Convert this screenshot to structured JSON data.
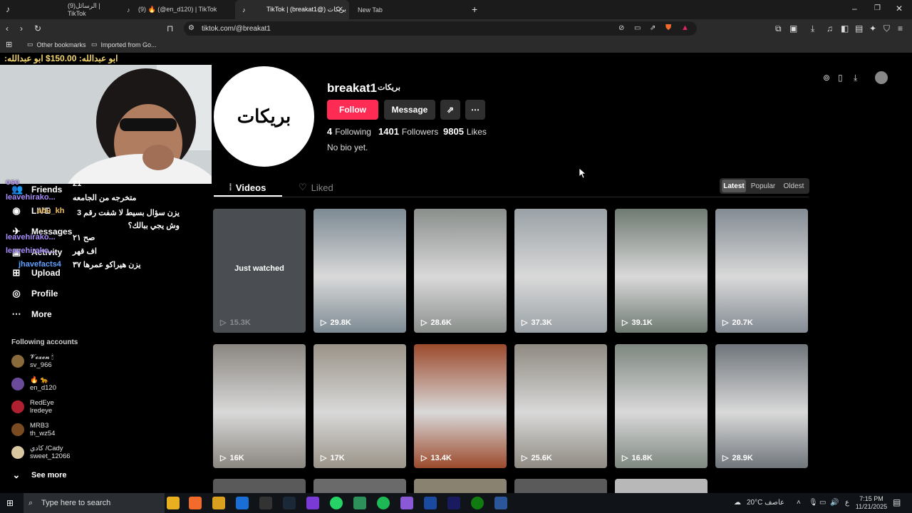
{
  "browser": {
    "tabs": [
      {
        "label": "(9)الرسائل | TikTok",
        "active": false
      },
      {
        "label": "(9) 🔥 (@en_d120) | TikTok",
        "active": false
      },
      {
        "label": "TikTok | (breakat1@) بريكات",
        "active": true
      },
      {
        "label": "New Tab",
        "active": false
      }
    ],
    "url": "tiktok.com/@breakat1",
    "bookmarks": [
      "Other bookmarks",
      "Imported from Go..."
    ]
  },
  "stream_overlay": {
    "top_text": "ابو عبدالله: 150.00$ ابو عبدالله:",
    "chat": [
      {
        "name": "leavehirako...",
        "msg": "متخرجه من الجامعه"
      },
      {
        "name": "abu_kh",
        "msg": "يزن سؤال بسيط لا شفت رقم 3 وش يجي ببالك؟"
      },
      {
        "name": "leavehirako...",
        "msg": "صح ٢١"
      },
      {
        "name": "leavehirako...",
        "msg": "اف قهر"
      },
      {
        "name": "jhavefacts4",
        "msg": "يزن هيراكو عمرها ٣٧"
      }
    ],
    "partial_num": "21"
  },
  "sidebar": {
    "items": [
      {
        "label": "Friends",
        "icon": "friends-icon"
      },
      {
        "label": "LIVE",
        "icon": "live-icon"
      },
      {
        "label": "Messages",
        "icon": "messages-icon",
        "badge": "3"
      },
      {
        "label": "Activity",
        "icon": "activity-icon"
      },
      {
        "label": "Upload",
        "icon": "upload-icon"
      },
      {
        "label": "Profile",
        "icon": "profile-icon"
      },
      {
        "label": "More",
        "icon": "more-icon"
      }
    ],
    "following_title": "Following accounts",
    "following": [
      {
        "name": "𝓥𝓮𝔁𝓮𝓷 🕯",
        "handle": "sv_966",
        "color": "#8a6a3a"
      },
      {
        "name": "🔥 🐆",
        "handle": "en_d120",
        "color": "#6a4a9a"
      },
      {
        "name": "RedEye",
        "handle": "lredeye",
        "color": "#b02030"
      },
      {
        "name": "MRB3",
        "handle": "th_wz54",
        "color": "#7a4a20"
      },
      {
        "name": "كادي /Cady",
        "handle": "sweet_12066",
        "color": "#d8c7a0"
      }
    ],
    "see_more": "See more"
  },
  "profile": {
    "username": "breakat1",
    "display_name": "بريكات",
    "avatar_text": "بريكات",
    "follow_label": "Follow",
    "message_label": "Message",
    "following_count": "4",
    "following_label": "Following",
    "followers_count": "1401",
    "followers_label": "Followers",
    "likes_count": "9805",
    "likes_label": "Likes",
    "bio": "No bio yet."
  },
  "content_tabs": {
    "videos": "Videos",
    "liked": "Liked"
  },
  "sort": [
    "Latest",
    "Popular",
    "Oldest"
  ],
  "videos": [
    {
      "views": "15.3K",
      "just_watched": "Just watched",
      "color": "#4a4e52"
    },
    {
      "views": "29.8K",
      "color": "#7d8a93"
    },
    {
      "views": "28.6K",
      "color": "#8a8f8c"
    },
    {
      "views": "37.3K",
      "color": "#9aa1a6"
    },
    {
      "views": "39.1K",
      "color": "#6f7a72"
    },
    {
      "views": "20.7K",
      "color": "#838b93"
    },
    {
      "views": "16K",
      "color": "#8b8680"
    },
    {
      "views": "17K",
      "color": "#9a9388"
    },
    {
      "views": "13.4K",
      "color": "#9c4a2c"
    },
    {
      "views": "25.6K",
      "color": "#8f8a82"
    },
    {
      "views": "16.8K",
      "color": "#7e8780"
    },
    {
      "views": "28.9K",
      "color": "#6f757b"
    }
  ],
  "taskbar": {
    "search_placeholder": "Type here to search",
    "weather": "20°C عاصف",
    "time": "7:15 PM",
    "date": "11/21/2025",
    "lang": "ع"
  }
}
